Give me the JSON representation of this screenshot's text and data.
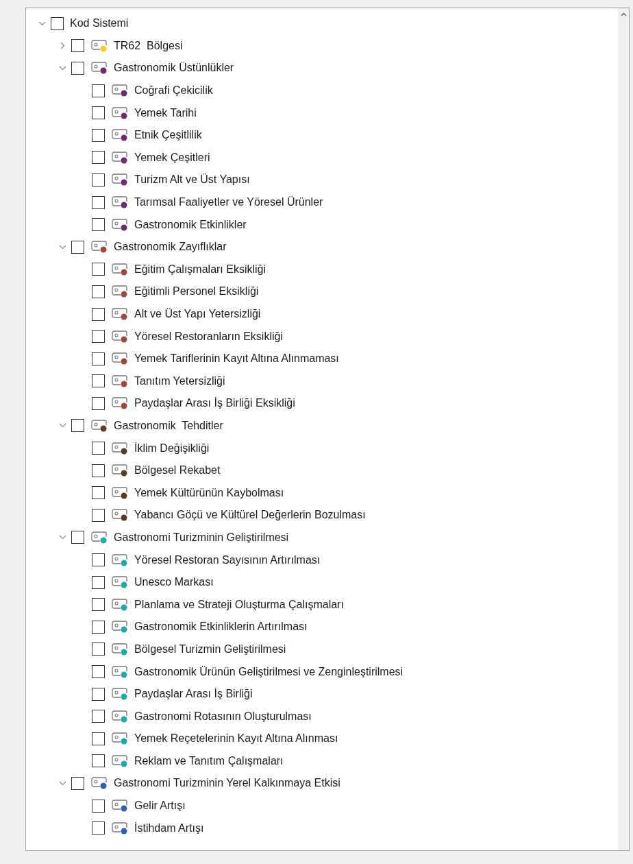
{
  "tree": {
    "label": "Kod Sistemi",
    "checked": false,
    "expanded": true,
    "children": [
      {
        "label": "TR62  Bölgesi",
        "checked": false,
        "expanded": false,
        "color": "#f2cf2e"
      },
      {
        "label": "Gastronomik Üstünlükler",
        "checked": false,
        "expanded": true,
        "color": "#6a2c6e",
        "children": [
          {
            "label": "Coğrafi Çekicilik",
            "checked": false,
            "color": "#6a2c6e"
          },
          {
            "label": "Yemek Tarihi",
            "checked": false,
            "color": "#6a2c6e"
          },
          {
            "label": "Etnik Çeşitlilik",
            "checked": false,
            "color": "#6a2c6e"
          },
          {
            "label": "Yemek Çeşitleri",
            "checked": false,
            "color": "#6a2c6e"
          },
          {
            "label": "Turizm Alt ve Üst Yapısı",
            "checked": false,
            "color": "#6a2c6e"
          },
          {
            "label": "Tarımsal Faaliyetler ve Yöresel Ürünler",
            "checked": false,
            "color": "#6a2c6e"
          },
          {
            "label": "Gastronomik Etkinlikler",
            "checked": false,
            "color": "#6a2c6e"
          }
        ]
      },
      {
        "label": "Gastronomik Zayıflıklar",
        "checked": false,
        "expanded": true,
        "color": "#a2473b",
        "children": [
          {
            "label": "Eğitim Çalışmaları Eksikliği",
            "checked": false,
            "color": "#a2473b"
          },
          {
            "label": "Eğitimli Personel Eksikliği",
            "checked": false,
            "color": "#a2473b"
          },
          {
            "label": "Alt ve Üst Yapı Yetersizliği",
            "checked": false,
            "color": "#a2473b"
          },
          {
            "label": "Yöresel Restoranların Eksikliği",
            "checked": false,
            "color": "#a2473b"
          },
          {
            "label": "Yemek Tariflerinin Kayıt Altına Alınmaması",
            "checked": false,
            "color": "#a2473b"
          },
          {
            "label": "Tanıtım Yetersizliği",
            "checked": false,
            "color": "#a2473b"
          },
          {
            "label": "Paydaşlar Arası İş Birliği Eksikliği",
            "checked": false,
            "color": "#a2473b"
          }
        ]
      },
      {
        "label": "Gastronomik  Tehditler",
        "checked": false,
        "expanded": true,
        "color": "#5b3b22",
        "children": [
          {
            "label": "İklim Değişikliği",
            "checked": false,
            "color": "#5b3b22"
          },
          {
            "label": "Bölgesel Rekabet",
            "checked": false,
            "color": "#5b3b22"
          },
          {
            "label": "Yemek Kültürünün Kaybolması",
            "checked": false,
            "color": "#5b3b22"
          },
          {
            "label": "Yabancı Göçü ve Kültürel Değerlerin Bozulması",
            "checked": false,
            "color": "#5b3b22"
          }
        ]
      },
      {
        "label": "Gastronomi Turizminin Geliştirilmesi",
        "checked": false,
        "expanded": true,
        "color": "#20a9a9",
        "children": [
          {
            "label": "Yöresel Restoran Sayısının Artırılması",
            "checked": false,
            "color": "#20a9a9"
          },
          {
            "label": "Unesco Markası",
            "checked": false,
            "color": "#20a9a9"
          },
          {
            "label": "Planlama ve Strateji Oluşturma Çalışmaları",
            "checked": false,
            "color": "#20a9a9"
          },
          {
            "label": "Gastronomik Etkinliklerin Artırılması",
            "checked": false,
            "color": "#20a9a9"
          },
          {
            "label": "Bölgesel Turizmin Geliştirilmesi",
            "checked": false,
            "color": "#20a9a9"
          },
          {
            "label": "Gastronomik Ürünün Geliştirilmesi ve Zenginleştirilmesi",
            "checked": false,
            "color": "#20a9a9"
          },
          {
            "label": "Paydaşlar Arası İş Birliği",
            "checked": false,
            "color": "#20a9a9"
          },
          {
            "label": "Gastronomi Rotasının Oluşturulması",
            "checked": false,
            "color": "#20a9a9"
          },
          {
            "label": "Yemek Reçetelerinin Kayıt Altına Alınması",
            "checked": false,
            "color": "#20a9a9"
          },
          {
            "label": "Reklam ve Tanıtım Çalışmaları",
            "checked": false,
            "color": "#20a9a9"
          }
        ]
      },
      {
        "label": "Gastronomi Turizminin Yerel Kalkınmaya Etkisi",
        "checked": false,
        "expanded": true,
        "color": "#2b64b2",
        "children": [
          {
            "label": "Gelir Artışı",
            "checked": false,
            "color": "#2b64b2"
          },
          {
            "label": "İstihdam Artışı",
            "checked": false,
            "color": "#2b64b2"
          }
        ]
      }
    ]
  }
}
